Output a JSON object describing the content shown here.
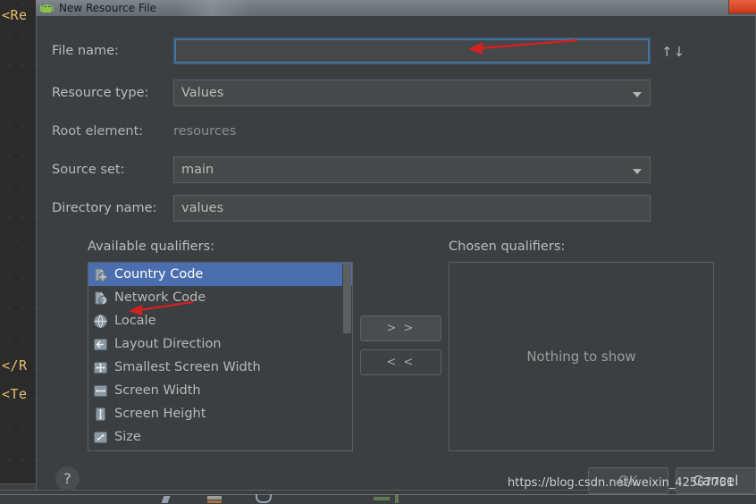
{
  "background": {
    "code_lines": [
      "<Re",
      "</R",
      "<Te"
    ]
  },
  "window": {
    "title": "New Resource File",
    "icon": "android-icon",
    "close_label": ""
  },
  "form": {
    "file_name": {
      "label": "File name:",
      "value": "",
      "placeholder": ""
    },
    "resource_type": {
      "label": "Resource type:",
      "value": "Values"
    },
    "root_element": {
      "label": "Root element:",
      "value": "resources"
    },
    "source_set": {
      "label": "Source set:",
      "value": "main"
    },
    "directory_name": {
      "label": "Directory name:",
      "value": "values"
    },
    "sort_toggle": "↑↓"
  },
  "qualifiers": {
    "available_label": "Available qualifiers:",
    "chosen_label": "Chosen qualifiers:",
    "available": [
      {
        "label": "Country Code",
        "icon": "country-code-icon",
        "selected": true
      },
      {
        "label": "Network Code",
        "icon": "network-code-icon",
        "selected": false
      },
      {
        "label": "Locale",
        "icon": "locale-globe-icon",
        "selected": false
      },
      {
        "label": "Layout Direction",
        "icon": "layout-direction-icon",
        "selected": false
      },
      {
        "label": "Smallest Screen Width",
        "icon": "smallest-screen-width-icon",
        "selected": false
      },
      {
        "label": "Screen Width",
        "icon": "screen-width-icon",
        "selected": false
      },
      {
        "label": "Screen Height",
        "icon": "screen-height-icon",
        "selected": false
      },
      {
        "label": "Size",
        "icon": "size-icon",
        "selected": false
      }
    ],
    "chosen_empty_text": "Nothing to show",
    "add_label": "> >",
    "remove_label": "< <"
  },
  "footer": {
    "help_label": "?",
    "ok_label": "OK",
    "cancel_label": "Cancel"
  },
  "annotations": {
    "arrow_color": "#d42020",
    "watermark": "https://blog.csdn.net/weixin_42567731"
  },
  "colors": {
    "dialog_background": "#3c3f41",
    "selection_blue": "#4b6eaf",
    "focus_border": "#4a7ba8",
    "title_bar": "#6e757c",
    "close_button": "#c9361b",
    "code_text": "#e8bf6a"
  }
}
